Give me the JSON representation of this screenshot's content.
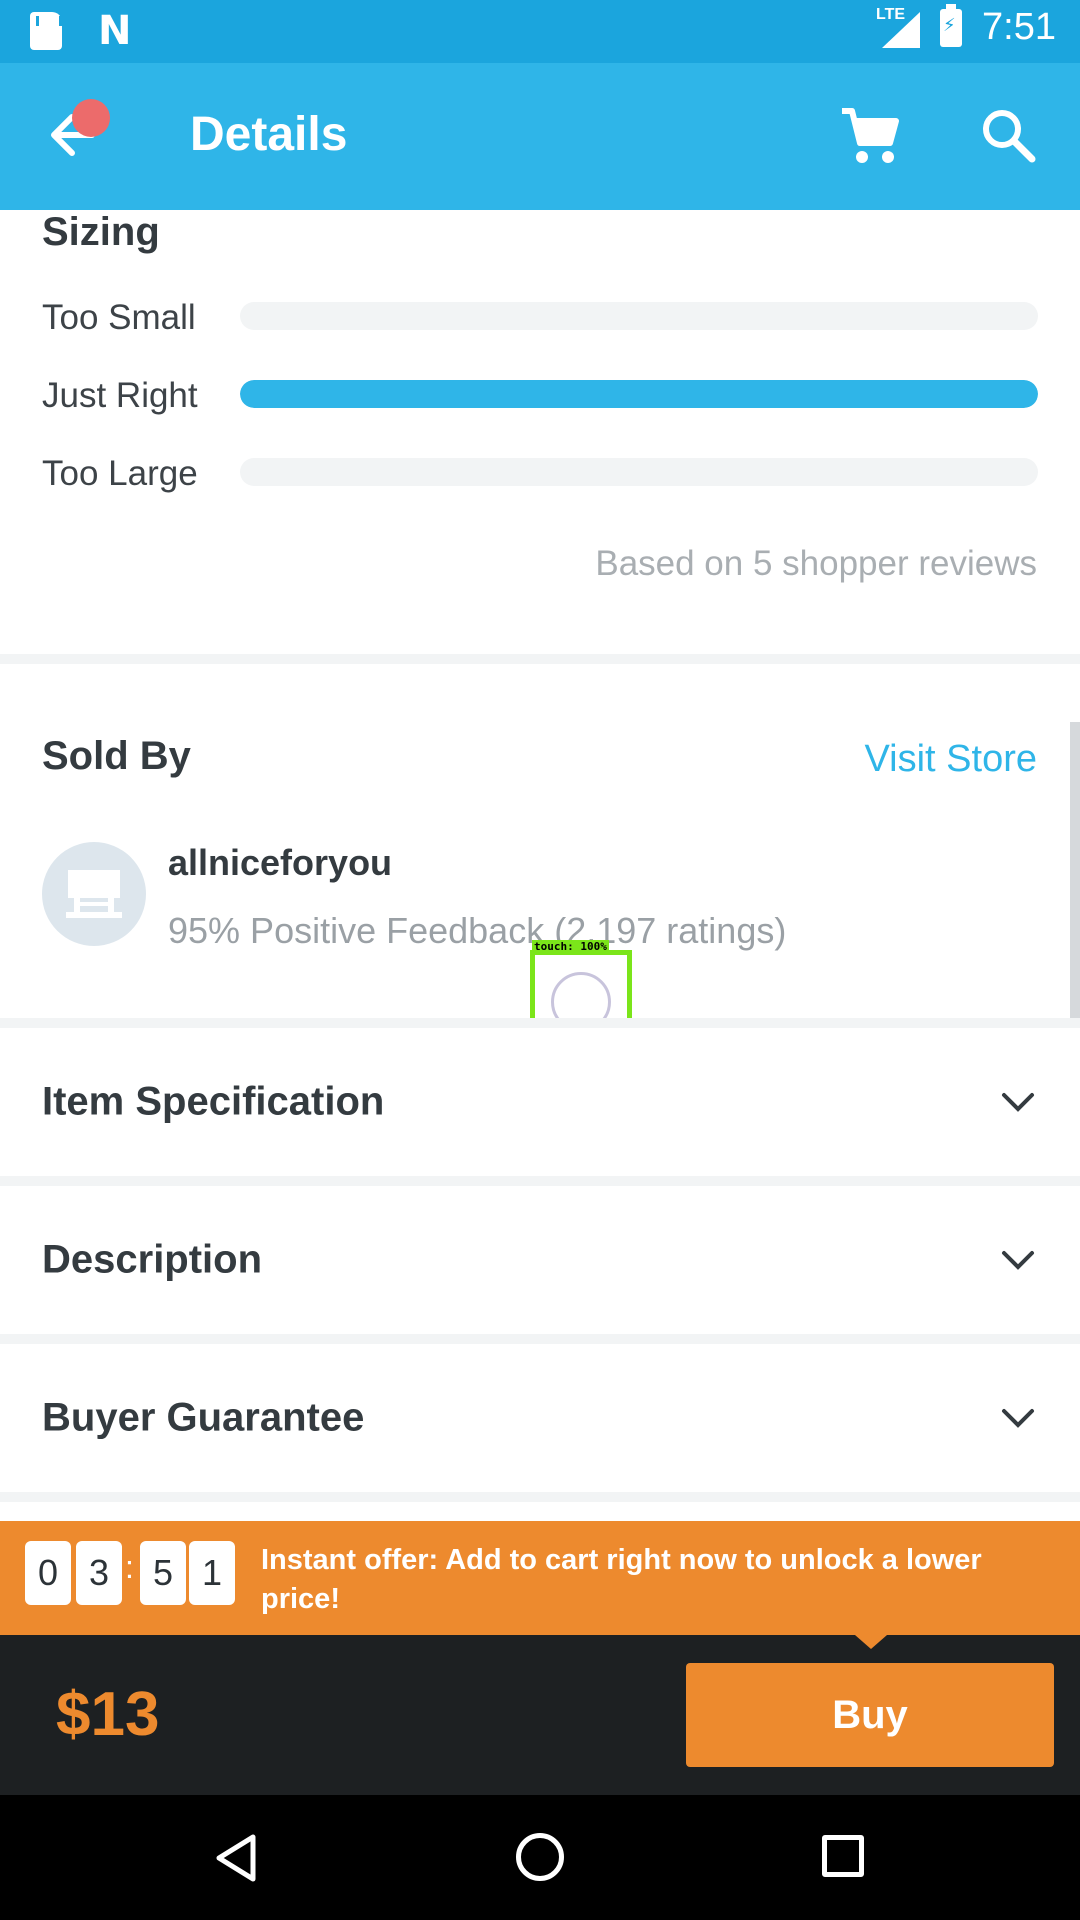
{
  "status_bar": {
    "network": "LTE",
    "time": "7:51"
  },
  "app_bar": {
    "title": "Details"
  },
  "sizing": {
    "title": "Sizing",
    "rows": [
      {
        "label": "Too Small",
        "fraction": 0.0
      },
      {
        "label": "Just Right",
        "fraction": 1.0
      },
      {
        "label": "Too Large",
        "fraction": 0.0
      }
    ],
    "note": "Based on 5 shopper reviews"
  },
  "sold_by": {
    "title": "Sold By",
    "visit_store_label": "Visit Store",
    "store_name": "allniceforyou",
    "feedback": "95% Positive Feedback (2,197 ratings)"
  },
  "touch_overlay": {
    "label": "touch: 100%"
  },
  "sections": {
    "item_specification": "Item Specification",
    "description": "Description",
    "buyer_guarantee": "Buyer Guarantee"
  },
  "offer": {
    "timer_digits": [
      "0",
      "3",
      "5",
      "1"
    ],
    "separator": ":",
    "text": "Instant offer: Add to cart right now to unlock a lower price!"
  },
  "buy_bar": {
    "price": "$13",
    "buy_label": "Buy"
  },
  "colors": {
    "accent": "#2fb5e8",
    "offer": "#ed8a2e",
    "dark": "#1d2022"
  }
}
